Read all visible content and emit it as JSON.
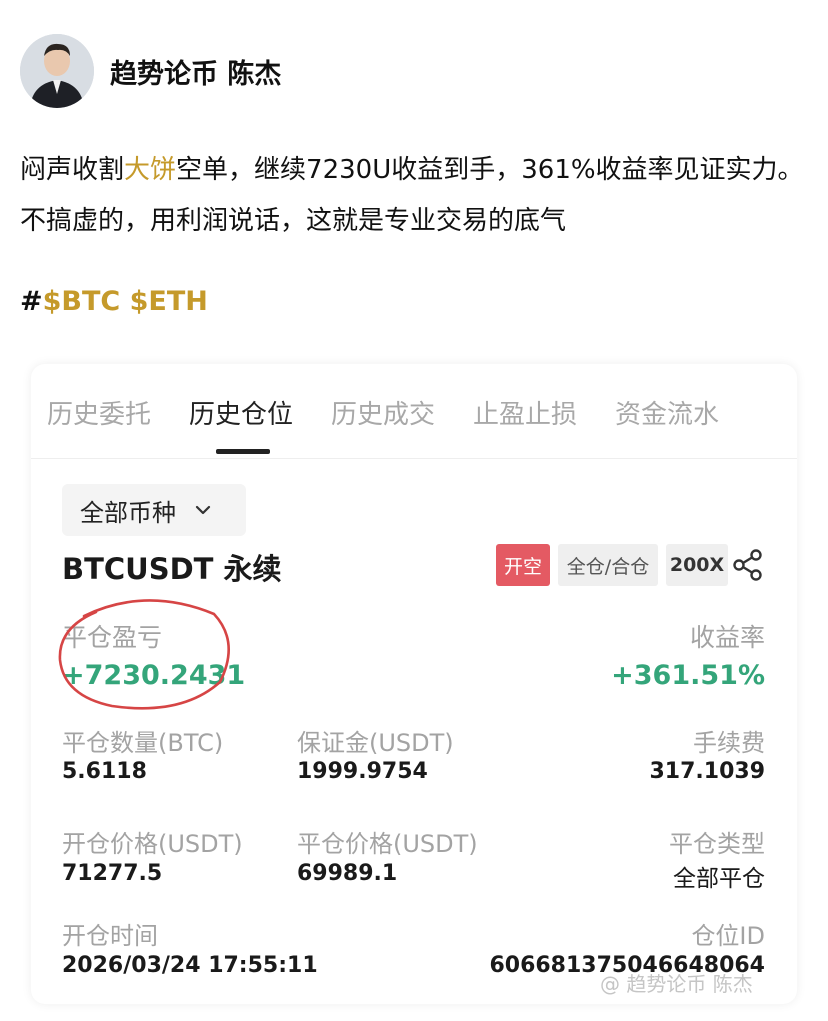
{
  "author": {
    "name": "趋势论币 陈杰"
  },
  "post": {
    "text_before": "闷声收割",
    "highlight": "大饼",
    "text_after": "空单，继续7230U收益到手，361%收益率见证实力。不搞虚的，用利润说话，这就是专业交易的底气",
    "hash": "#",
    "tags": "$BTC $ETH"
  },
  "tabs": [
    {
      "label": "历史委托",
      "active": false
    },
    {
      "label": "历史仓位",
      "active": true
    },
    {
      "label": "历史成交",
      "active": false
    },
    {
      "label": "止盈止损",
      "active": false
    },
    {
      "label": "资金流水",
      "active": false
    }
  ],
  "filter": {
    "label": "全部币种"
  },
  "position": {
    "symbol": "BTCUSDT 永续",
    "side_badge": "开空",
    "margin_mode": "全仓/合仓",
    "leverage": "200X",
    "pnl_label": "平仓盈亏",
    "pnl_value": "+7230.2431",
    "roi_label": "收益率",
    "roi_value": "+361.51%",
    "close_qty_label": "平仓数量(BTC)",
    "close_qty_value": "5.6118",
    "margin_label": "保证金(USDT)",
    "margin_value": "1999.9754",
    "fee_label": "手续费",
    "fee_value": "317.1039",
    "open_price_label": "开仓价格(USDT)",
    "open_price_value": "71277.5",
    "close_price_label": "平仓价格(USDT)",
    "close_price_value": "69989.1",
    "close_type_label": "平仓类型",
    "close_type_value": "全部平仓",
    "open_time_label": "开仓时间",
    "open_time_value": "2026/03/24 17:55:11",
    "position_id_label": "仓位ID",
    "position_id_value": "6066813750466480​64"
  },
  "watermark": "@ 趋势论币 陈杰",
  "colors": {
    "highlight": "#c59a2b",
    "profit": "#34a57a",
    "short_badge": "#e45a63",
    "annotation_circle": "#d64545"
  }
}
